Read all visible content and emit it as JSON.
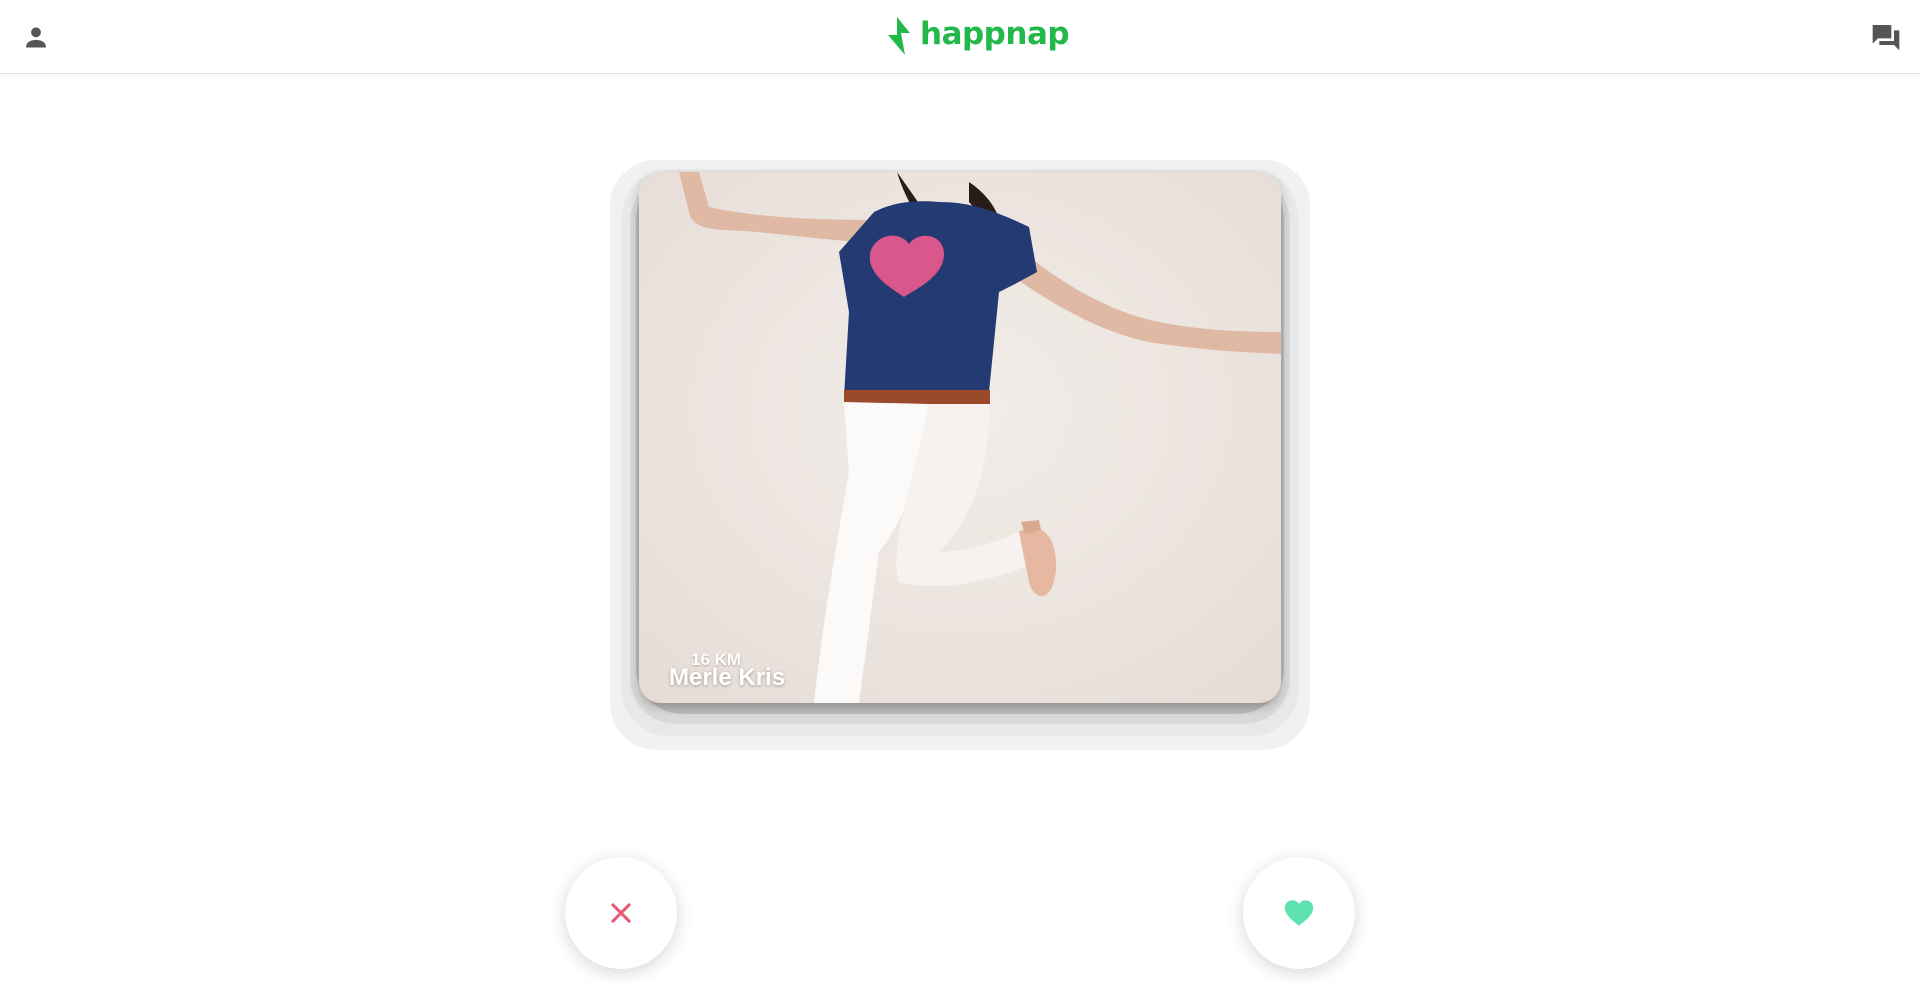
{
  "header": {
    "brand_name": "happnap",
    "brand_color": "#22b94a",
    "profile_icon": "person-icon",
    "chat_icon": "forum-icon",
    "logo_icon": "lightning-bolt-icon",
    "icon_color": "#555555"
  },
  "card": {
    "distance": "16 KM",
    "name": "Merle Kris"
  },
  "actions": {
    "dislike_icon": "close-icon",
    "dislike_color": "#e85a74",
    "like_icon": "heart-icon",
    "like_color": "#5ee3b0"
  }
}
